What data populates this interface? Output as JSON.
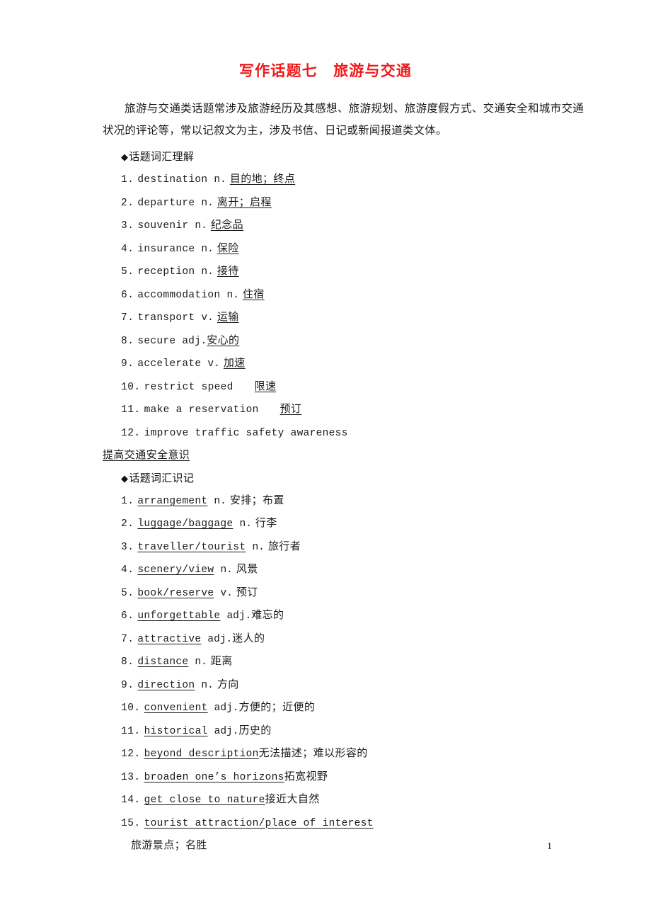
{
  "document": {
    "title": "写作话题七　旅游与交通",
    "title_color": "#ef1a1a",
    "page_number": "1",
    "intro": "旅游与交通类话题常涉及旅游经历及其感想、旅游规划、旅游度假方式、交通安全和城市交通状况的评论等，常以记叙文为主，涉及书信、日记或新闻报道类文体。"
  },
  "section1": {
    "heading_marker": "◆",
    "heading": "话题词汇理解",
    "items": [
      {
        "num": "1.",
        "en": "destination",
        "pos": "n.",
        "cn": "目的地；终点"
      },
      {
        "num": "2.",
        "en": "departure",
        "pos": "n.",
        "cn": "离开；启程"
      },
      {
        "num": "3.",
        "en": "souvenir",
        "pos": "n.",
        "cn": "纪念品"
      },
      {
        "num": "4.",
        "en": "insurance",
        "pos": "n.",
        "cn": "保险"
      },
      {
        "num": "5.",
        "en": "reception",
        "pos": "n.",
        "cn": "接待"
      },
      {
        "num": "6.",
        "en": "accommodation",
        "pos": "n.",
        "cn": "住宿"
      },
      {
        "num": "7.",
        "en": "transport",
        "pos": "v.",
        "cn": "运输"
      },
      {
        "num": "8.",
        "en": "secure",
        "pos": "adj.",
        "cn": "安心的"
      },
      {
        "num": "9.",
        "en": "accelerate",
        "pos": "v.",
        "cn": "加速"
      },
      {
        "num": "10.",
        "en": "restrict speed",
        "pos": "",
        "cn": "限速"
      },
      {
        "num": "11.",
        "en": "make a reservation",
        "pos": "",
        "cn": "预订"
      }
    ],
    "item12": {
      "num": "12.",
      "en": "improve traffic safety awareness",
      "cn": "提高交通安全意识"
    }
  },
  "section2": {
    "heading_marker": "◆",
    "heading": "话题词汇识记",
    "items": [
      {
        "num": "1.",
        "en": "arrangement",
        "pos": "n.",
        "cn": "安排；布置"
      },
      {
        "num": "2.",
        "en": "luggage/baggage",
        "pos": "n.",
        "cn": "行李"
      },
      {
        "num": "3.",
        "en": "traveller/tourist",
        "pos": "n.",
        "cn": "旅行者"
      },
      {
        "num": "4.",
        "en": "scenery/view",
        "pos": "n.",
        "cn": "风景"
      },
      {
        "num": "5.",
        "en": "book/reserve",
        "pos": "v.",
        "cn": "预订"
      },
      {
        "num": "6.",
        "en": "unforgettable",
        "pos": "adj.",
        "cn": "难忘的"
      },
      {
        "num": "7.",
        "en": "attractive",
        "pos": "adj.",
        "cn": "迷人的"
      },
      {
        "num": "8.",
        "en": "distance",
        "pos": "n.",
        "cn": "距离"
      },
      {
        "num": "9.",
        "en": "direction",
        "pos": "n.",
        "cn": "方向"
      },
      {
        "num": "10.",
        "en": "convenient",
        "pos": "adj.",
        "cn": "方便的；近便的"
      },
      {
        "num": "11.",
        "en": "historical",
        "pos": "adj.",
        "cn": "历史的"
      },
      {
        "num": "12.",
        "en": "beyond description",
        "pos": "",
        "cn": "无法描述；难以形容的"
      },
      {
        "num": "13.",
        "en": "broaden one’s horizons",
        "pos": "",
        "cn": "拓宽视野"
      },
      {
        "num": "14.",
        "en": "get close to nature",
        "pos": "",
        "cn": "接近大自然"
      }
    ],
    "item15": {
      "num": "15.",
      "en": "tourist attraction/place of interest",
      "cn": "旅游景点；名胜"
    }
  }
}
